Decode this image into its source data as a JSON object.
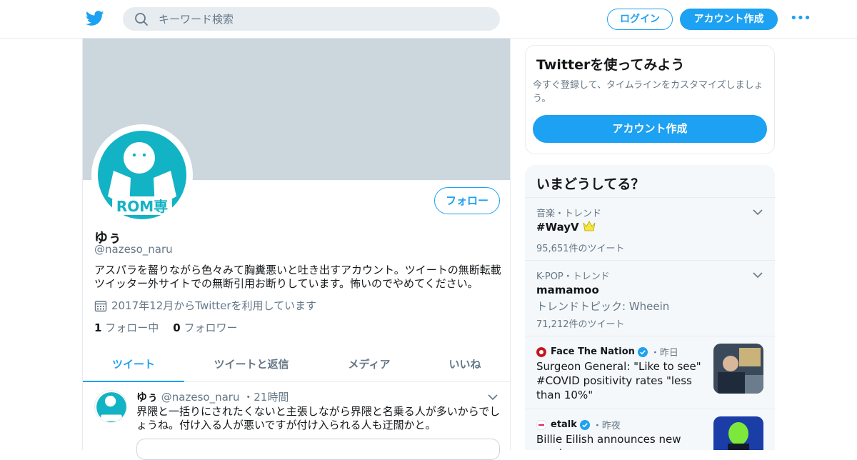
{
  "header": {
    "search_placeholder": "キーワード検索",
    "login_label": "ログイン",
    "signup_label": "アカウント作成",
    "more_label": "•••"
  },
  "profile": {
    "follow_label": "フォロー",
    "name": "ゆぅ",
    "handle": "@nazeso_naru",
    "bio": "アスパラを齧りながら色々みて胸糞悪いと吐き出すアカウント。ツイートの無断転載ツイッター外サイトでの無断引用お断りしています。怖いのでやめてください。",
    "joined": "2017年12月からTwitterを利用しています",
    "following_count": "1",
    "following_label": "フォロー中",
    "followers_count": "0",
    "followers_label": "フォロワー",
    "avatar_text": "ROM専"
  },
  "tabs": [
    {
      "label": "ツイート"
    },
    {
      "label": "ツイートと返信"
    },
    {
      "label": "メディア"
    },
    {
      "label": "いいね"
    }
  ],
  "tweet": {
    "name": "ゆぅ",
    "handle": "@nazeso_naru",
    "time": "・21時間",
    "text": "界隈と一括りにされたくないと主張しながら界隈と名乗る人が多いからでしょうね。付け入る人が悪いですが付け入られる人も迂闊かと。"
  },
  "signup_card": {
    "title": "Twitterを使ってみよう",
    "description": "今すぐ登録して、タイムラインをカスタマイズしましょう。",
    "button": "アカウント作成"
  },
  "trends": {
    "title": "いまどうしてる？",
    "items": [
      {
        "meta": "音楽・トレンド",
        "title": "#WayV",
        "sub": "",
        "count": "95,651件のツイート"
      },
      {
        "meta": "K-POP・トレンド",
        "title": "mamamoo",
        "sub": "トレンドトピック: Wheein",
        "count": "71,212件のツイート"
      }
    ],
    "news": [
      {
        "source": "Face The Nation",
        "time": "・昨日",
        "headline": "Surgeon General: \"Like to see\" #COVID positivity rates \"less than 10%\""
      },
      {
        "source": "etalk",
        "time": "・昨夜",
        "headline": "Billie Eilish announces new music"
      }
    ]
  },
  "colors": {
    "accent": "#1da1f2",
    "banner": "#ccd6dd",
    "avatar_teal": "#12b3c4"
  }
}
